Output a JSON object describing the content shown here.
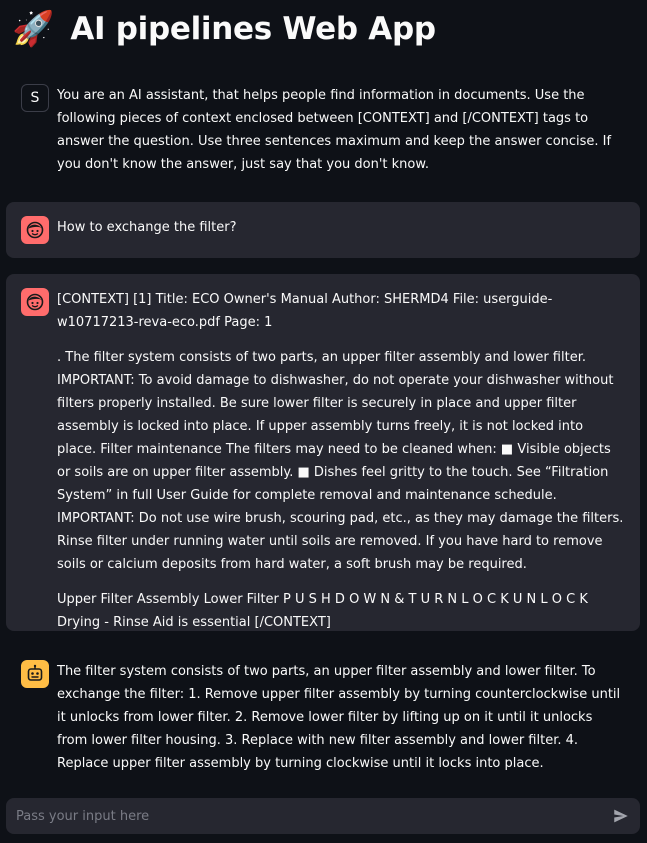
{
  "header": {
    "icon": "rocket-icon",
    "title": "AI pipelines Web App"
  },
  "messages": [
    {
      "role": "system",
      "avatar_letter": "S",
      "paragraphs": [
        "You are an AI assistant, that helps people find information in documents. Use the following pieces of context enclosed between [CONTEXT] and [/CONTEXT] tags to answer the question. Use three sentences maximum and keep the answer concise. If you don't know the answer, just say that you don't know."
      ]
    },
    {
      "role": "user",
      "avatar_icon": "user-face-icon",
      "paragraphs": [
        "How to exchange the filter?"
      ]
    },
    {
      "role": "user",
      "avatar_icon": "user-face-icon",
      "paragraphs": [
        "[CONTEXT] [1] Title: ECO Owner's Manual Author: SHERMD4 File: userguide-w10717213-reva-eco.pdf Page: 1",
        ". The filter system consists of two parts, an upper filter assembly and lower filter. IMPORTANT: To avoid damage to dishwasher, do not operate your dishwasher without filters properly installed. Be sure lower filter is securely in place and upper filter assembly is locked into place. If upper assembly turns freely, it is not locked into place. Filter maintenance The filters may need to be cleaned when: ■ Visible objects or soils are on upper filter assembly. ■ Dishes feel gritty to the touch. See “Filtration System” in full User Guide for complete removal and maintenance schedule. IMPORTANT: Do not use wire brush, scouring pad, etc., as they may damage the filters. Rinse filter under running water until soils are removed. If you have hard to remove soils or calcium deposits from hard water, a soft brush may be required.",
        "Upper Filter Assembly Lower Filter P U S H D O W N & T U R N L O C K U N L O C K Drying - Rinse Aid is essential [/CONTEXT]"
      ]
    },
    {
      "role": "assistant",
      "avatar_icon": "bot-face-icon",
      "paragraphs": [
        "The filter system consists of two parts, an upper filter assembly and lower filter. To exchange the filter: 1. Remove upper filter assembly by turning counterclockwise until it unlocks from lower filter. 2. Remove lower filter by lifting up on it until it unlocks from lower filter housing. 3. Replace with new filter assembly and lower filter. 4. Replace upper filter assembly by turning clockwise until it locks into place."
      ]
    }
  ],
  "chat_input": {
    "value": "",
    "placeholder": "Pass your input here",
    "send_icon": "send-icon"
  },
  "colors": {
    "background": "#0e1117",
    "message_background": "#262730",
    "user_avatar": "#ff6c6c",
    "assistant_avatar": "#ffbd45",
    "text": "#fafafa"
  }
}
